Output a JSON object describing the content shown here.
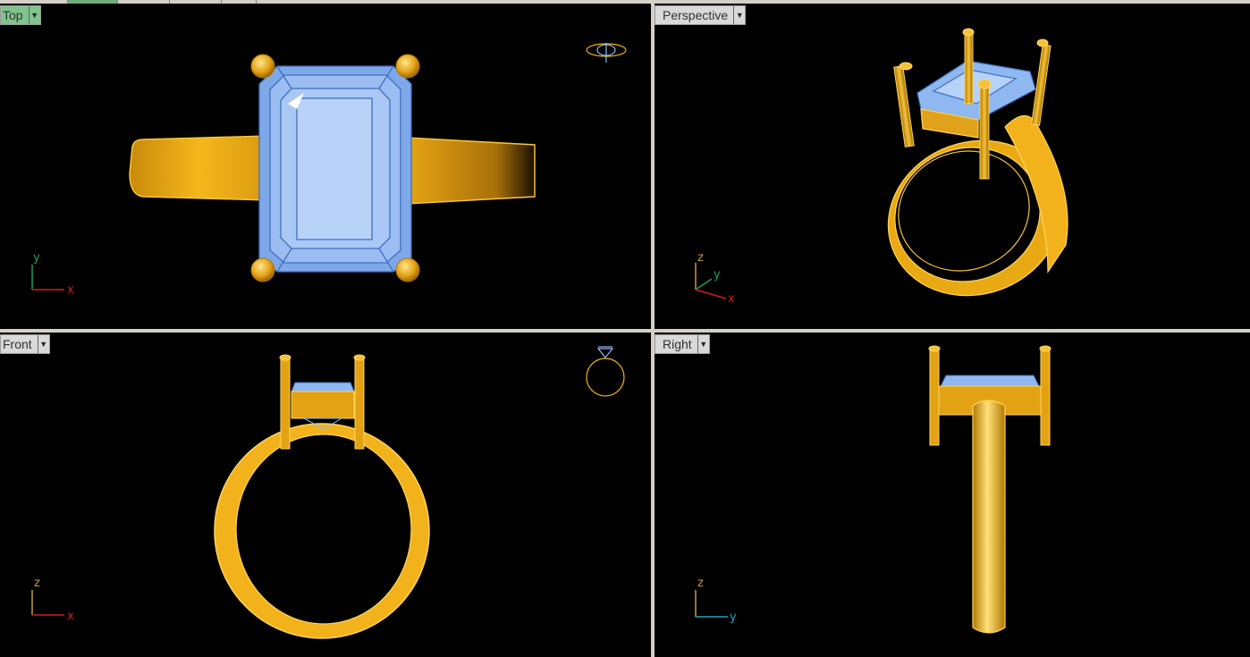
{
  "viewports": {
    "top": {
      "title": "Top",
      "active": true
    },
    "perspective": {
      "title": "Perspective",
      "active": false
    },
    "front": {
      "title": "Front",
      "active": false
    },
    "right": {
      "title": "Right",
      "active": false
    }
  },
  "axes": {
    "top": {
      "vertical": "y",
      "horizontal": "x"
    },
    "perspective": {
      "vertical": "z",
      "depth": "y",
      "horizontal": "x"
    },
    "front": {
      "vertical": "z",
      "horizontal": "x"
    },
    "right": {
      "vertical": "z",
      "horizontal": "y"
    }
  },
  "dropdown_glyph": "▼",
  "colors": {
    "gold": "#f2b21c",
    "gem": "#8fb8f0",
    "axis_x": "#d01c1c",
    "axis_y_green": "#1ca060",
    "axis_z": "#c89a3a",
    "axis_y_cyan": "#1aa6c8"
  }
}
